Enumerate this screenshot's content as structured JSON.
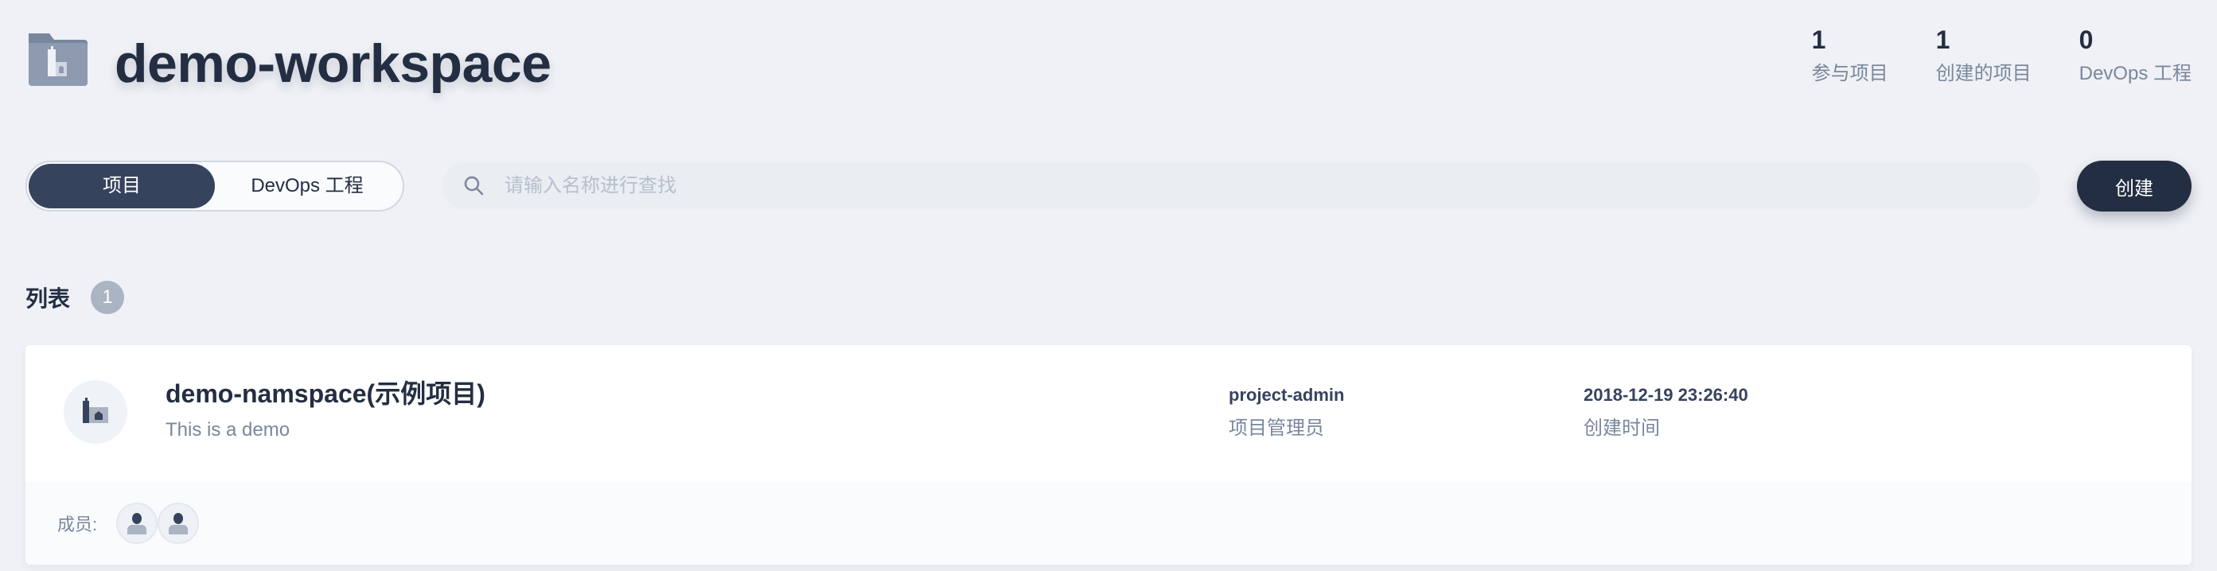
{
  "header": {
    "title": "demo-workspace",
    "stats": [
      {
        "value": "1",
        "label": "参与项目"
      },
      {
        "value": "1",
        "label": "创建的项目"
      },
      {
        "value": "0",
        "label": "DevOps 工程"
      }
    ]
  },
  "toolbar": {
    "tabs": [
      {
        "label": "项目",
        "active": true
      },
      {
        "label": "DevOps 工程",
        "active": false
      }
    ],
    "search_placeholder": "请输入名称进行查找",
    "search_value": "",
    "create_label": "创建"
  },
  "list": {
    "title": "列表",
    "count": "1",
    "items": [
      {
        "name": "demo-namspace(示例项目)",
        "description": "This is a demo",
        "role_value": "project-admin",
        "role_label": "项目管理员",
        "created_value": "2018-12-19 23:26:40",
        "created_label": "创建时间",
        "members_label": "成员:",
        "members_icon": "user-avatar-icon"
      }
    ]
  },
  "colors": {
    "background": "#eff1f6",
    "primary": "#242e42",
    "active_tab": "#36435c",
    "muted_text": "#79879c"
  }
}
